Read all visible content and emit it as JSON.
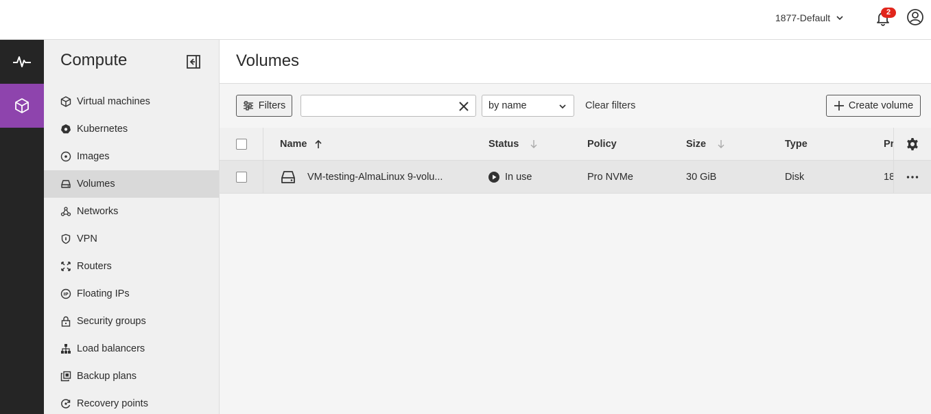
{
  "topbar": {
    "project_name": "1877-Default",
    "notification_count": "2"
  },
  "rail": {
    "items": [
      "monitoring-icon",
      "compute-icon"
    ]
  },
  "sidebar": {
    "title": "Compute",
    "items": [
      {
        "label": "Virtual machines",
        "icon": "cube-icon"
      },
      {
        "label": "Kubernetes",
        "icon": "kubernetes-icon"
      },
      {
        "label": "Images",
        "icon": "disc-icon"
      },
      {
        "label": "Volumes",
        "icon": "drive-icon",
        "active": true
      },
      {
        "label": "Networks",
        "icon": "network-icon"
      },
      {
        "label": "VPN",
        "icon": "shield-icon"
      },
      {
        "label": "Routers",
        "icon": "router-icon"
      },
      {
        "label": "Floating IPs",
        "icon": "ip-icon"
      },
      {
        "label": "Security groups",
        "icon": "lock-icon"
      },
      {
        "label": "Load balancers",
        "icon": "hierarchy-icon"
      },
      {
        "label": "Backup plans",
        "icon": "backup-icon"
      },
      {
        "label": "Recovery points",
        "icon": "recovery-icon"
      }
    ]
  },
  "main": {
    "title": "Volumes",
    "toolbar": {
      "filters_label": "Filters",
      "search_value": "",
      "sort_value": "by name",
      "clear_filters_label": "Clear filters",
      "create_label": "Create volume"
    },
    "table": {
      "columns": {
        "name": "Name",
        "status": "Status",
        "policy": "Policy",
        "size": "Size",
        "type": "Type",
        "project": "Pr"
      },
      "rows": [
        {
          "name": "VM-testing-AlmaLinux 9-volu...",
          "status": "In use",
          "policy": "Pro NVMe",
          "size": "30 GiB",
          "type": "Disk",
          "project": "18"
        }
      ]
    }
  },
  "colors": {
    "accent": "#8e44ad",
    "rail_bg": "#252525",
    "badge": "#e1261c"
  }
}
